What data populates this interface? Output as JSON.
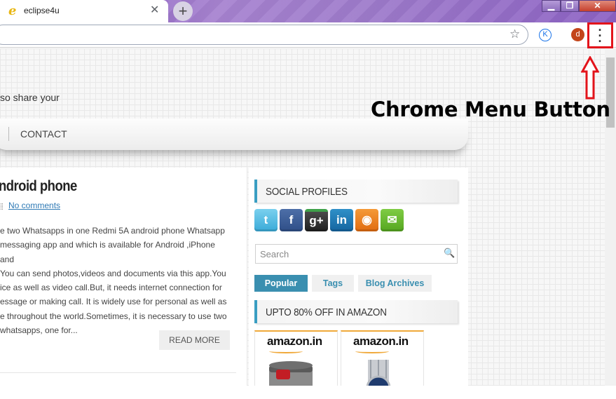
{
  "browser": {
    "tab_title": "eclipse4u",
    "tab_favicon_glyph": "e",
    "tab_close_glyph": "✕",
    "new_tab_glyph": "+",
    "avatar_initial": "d",
    "extension_glyph": "K",
    "menu_glyph": "⋮",
    "star_glyph": "☆",
    "window_controls": {
      "minimize": "▁",
      "maximize": "❐",
      "close": "✕"
    }
  },
  "annotation": {
    "label": "Chrome Menu Button",
    "color": "#e3141b"
  },
  "page": {
    "tagline": "so share your",
    "nav": {
      "contact": "CONTACT"
    },
    "post": {
      "title": "ndroid phone",
      "comments_link": "No comments",
      "excerpt": "e two Whatsapps in one Redmi 5A android phone Whatsapp\nmessaging app and which is available for Android ,iPhone and\nYou can send photos,videos and documents via this app.You\nice as well as video call.But, it needs internet connection for\nessage or making call. It is widely use for personal as well as\ne throughout the world.Sometimes, it is necessary to use two\nwhatsapps, one for...",
      "read_more": "READ MORE"
    },
    "sidebar": {
      "social_title": "SOCIAL PROFILES",
      "social": [
        {
          "name": "twitter-icon",
          "glyph": "t",
          "color": "#3aaad8"
        },
        {
          "name": "facebook-icon",
          "glyph": "f",
          "color": "#2f4f88"
        },
        {
          "name": "google-plus-icon",
          "glyph": "g+",
          "color": "#1f1f1f"
        },
        {
          "name": "linkedin-icon",
          "glyph": "in",
          "color": "#1565a0"
        },
        {
          "name": "rss-icon",
          "glyph": "◉",
          "color": "#e06b10"
        },
        {
          "name": "email-icon",
          "glyph": "✉",
          "color": "#55a620"
        }
      ],
      "search_placeholder": "Search",
      "tabs": [
        "Popular",
        "Tags",
        "Blog Archives"
      ],
      "amazon_title": "UPTO 80% OFF IN AMAZON",
      "products": [
        {
          "logo": "amazon.in"
        },
        {
          "logo": "amazon.in"
        }
      ]
    }
  }
}
